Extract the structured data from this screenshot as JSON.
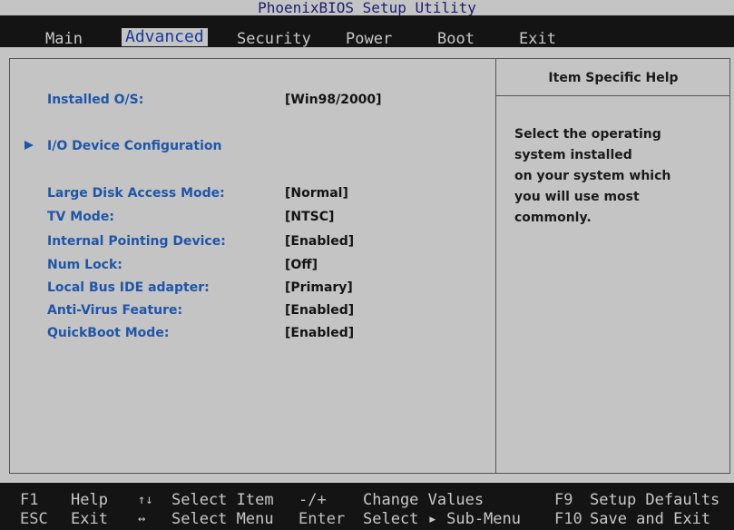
{
  "title": "PhoenixBIOS Setup Utility",
  "menu": [
    {
      "label": "Main"
    },
    {
      "label": "Advanced",
      "active": true
    },
    {
      "label": "Security"
    },
    {
      "label": "Power"
    },
    {
      "label": "Boot"
    },
    {
      "label": "Exit"
    }
  ],
  "settings": [
    {
      "label": "Installed O/S:",
      "value": "[Win98/2000]"
    },
    {
      "label": "I/O Device Configuration",
      "submenu": true
    },
    {
      "label": "Large Disk Access Mode:",
      "value": "[Normal]"
    },
    {
      "label": "TV Mode:",
      "value": "[NTSC]"
    },
    {
      "label": "Internal Pointing Device:",
      "value": "[Enabled]"
    },
    {
      "label": "Num Lock:",
      "value": "[Off]"
    },
    {
      "label": "Local Bus IDE adapter:",
      "value": "[Primary]"
    },
    {
      "label": "Anti-Virus Feature:",
      "value": "[Enabled]"
    },
    {
      "label": "QuickBoot Mode:",
      "value": "[Enabled]"
    }
  ],
  "help": {
    "title": "Item Specific Help",
    "text": "Select the operating\nsystem installed\non your system which\nyou will use most\ncommonly."
  },
  "footer": {
    "row1": [
      {
        "key": "F1",
        "action": "Help"
      },
      {
        "key": "↑↓",
        "action": "Select Item"
      },
      {
        "key": "-/+",
        "action": "Change Values"
      },
      {
        "key": "F9",
        "action": "Setup Defaults"
      }
    ],
    "row2": [
      {
        "key": "ESC",
        "action": "Exit"
      },
      {
        "key": "↔",
        "action": "Select Menu"
      },
      {
        "key": "Enter",
        "action": "Select ▸ Sub-Menu"
      },
      {
        "key": "F10",
        "action": "Save and Exit"
      }
    ]
  },
  "colors": {
    "background": "#c4c4c4",
    "bar": "#141414",
    "label": "#1f56a8",
    "value": "#141414"
  }
}
